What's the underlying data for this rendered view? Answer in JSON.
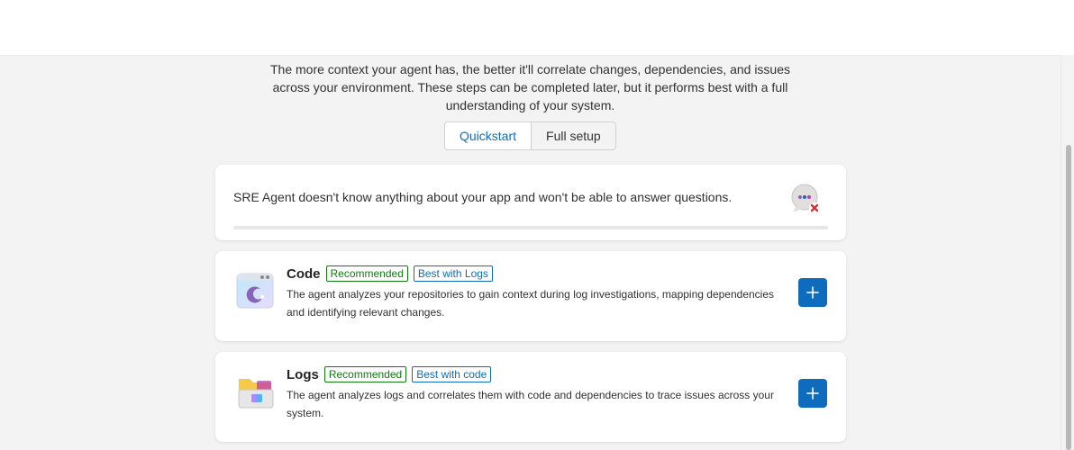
{
  "header": {
    "title": "",
    "intro": "The more context your agent has, the better it'll correlate changes, dependencies, and issues across your environment. These steps can be completed later, but it performs best with a full understanding of your system."
  },
  "mode_toggle": {
    "options": [
      {
        "label": "Quickstart",
        "selected": true
      },
      {
        "label": "Full setup",
        "selected": false
      }
    ]
  },
  "status": {
    "message": "SRE Agent doesn't know anything about your app and won't be able to answer questions.",
    "progress": 0,
    "icon": "chat-error-icon"
  },
  "items": [
    {
      "title": "Code",
      "badges": [
        {
          "label": "Recommended",
          "color": "#107c10"
        },
        {
          "label": "Best with Logs",
          "color": "#0f6cbd"
        }
      ],
      "description": "The agent analyzes your repositories to gain context during log investigations, mapping dependencies and identifying relevant changes.",
      "icon": "code-window-icon"
    },
    {
      "title": "Logs",
      "badges": [
        {
          "label": "Recommended",
          "color": "#107c10"
        },
        {
          "label": "Best with code",
          "color": "#0f6cbd"
        }
      ],
      "description": "The agent analyzes logs and correlates them with code and dependencies to trace issues across your system.",
      "icon": "logs-folder-icon"
    }
  ],
  "colors": {
    "accent": "#0f6cbd",
    "success": "#107c10",
    "background": "#f3f3f3",
    "error": "#d13438"
  }
}
